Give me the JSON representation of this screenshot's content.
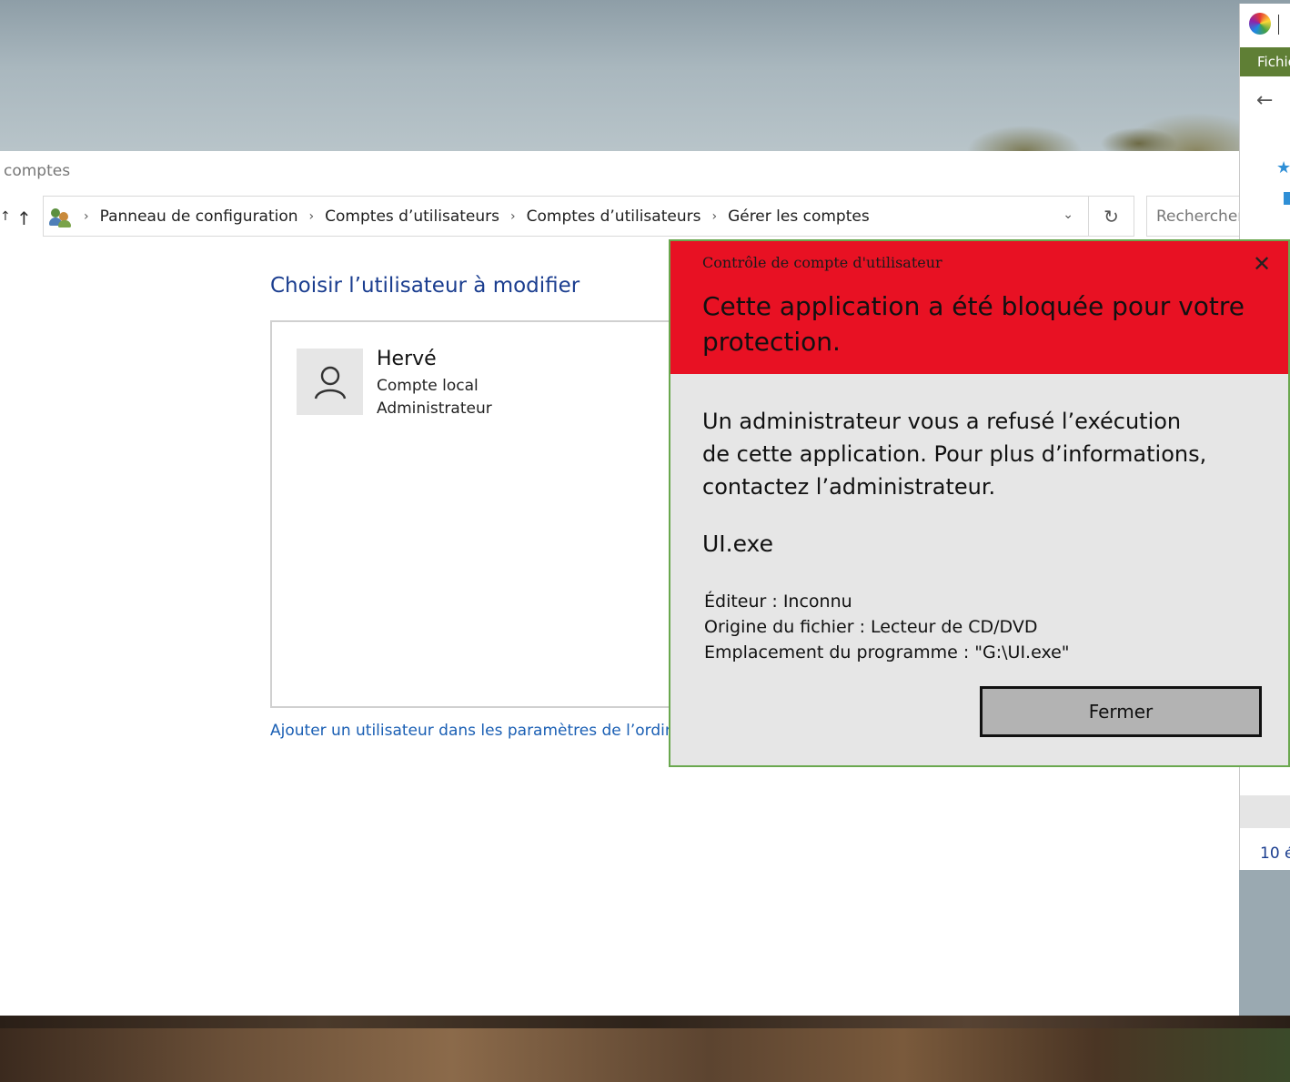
{
  "explorer": {
    "window_title": "comptes",
    "breadcrumb": [
      "Panneau de configuration",
      "Comptes d’utilisateurs",
      "Comptes d’utilisateurs",
      "Gérer les comptes"
    ],
    "search_placeholder": "Rechercher",
    "page_title": "Choisir l’utilisateur à modifier",
    "user": {
      "name": "Hervé",
      "account_type": "Compte local",
      "role": "Administrateur"
    },
    "add_user_link": "Ajouter un utilisateur dans les paramètres de l’ordinateur"
  },
  "side_window": {
    "ribbon_tab": "Fichier",
    "item_count": "10 é"
  },
  "uac_dialog": {
    "caption": "Contrôle de compte d'utilisateur",
    "headline": "Cette application a été bloquée pour votre protection.",
    "message": "Un administrateur vous a refusé l’exécution de cette application. Pour plus d’informations, contactez l’administrateur.",
    "program_name": "UI.exe",
    "details": {
      "publisher": "Éditeur : Inconnu",
      "origin": "Origine du fichier : Lecteur de CD/DVD",
      "location": "Emplacement du programme : \"G:\\UI.exe\""
    },
    "close_button_label": "Fermer",
    "header_color": "#e81123",
    "border_color": "#6aa84f"
  }
}
